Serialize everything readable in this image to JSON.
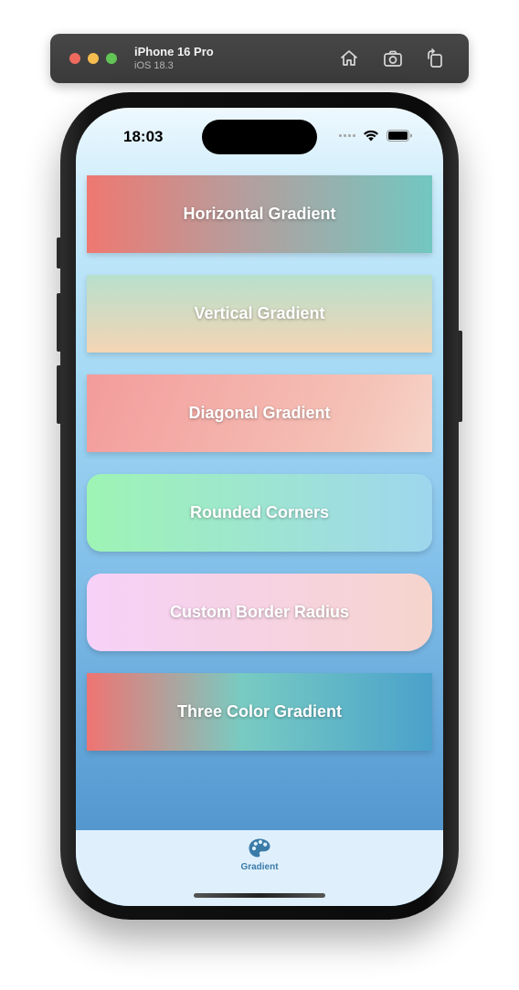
{
  "simulator": {
    "device_name": "iPhone 16 Pro",
    "os_version": "iOS 18.3",
    "buttons": [
      "home-icon",
      "screenshot-icon",
      "rotate-icon"
    ]
  },
  "status_bar": {
    "time": "18:03",
    "icons": [
      "cellular-icon",
      "wifi-icon",
      "battery-icon"
    ]
  },
  "cards": [
    {
      "label": "Horizontal Gradient",
      "colors": [
        "#ef7871",
        "#72c7c1"
      ]
    },
    {
      "label": "Vertical Gradient",
      "colors": [
        "#b7e0cd",
        "#f4d5b4"
      ]
    },
    {
      "label": "Diagonal Gradient",
      "colors": [
        "#f39c9c",
        "#f6d4c8"
      ]
    },
    {
      "label": "Rounded Corners",
      "colors": [
        "#9ef4b4",
        "#9ed6ee"
      ]
    },
    {
      "label": "Custom Border Radius",
      "colors": [
        "#f7d1f8",
        "#f5d4cd"
      ]
    },
    {
      "label": "Three Color Gradient",
      "colors": [
        "#ef7472",
        "#78cbc2",
        "#4aa1cb"
      ]
    }
  ],
  "tab_bar": {
    "items": [
      {
        "label": "Gradient",
        "icon": "palette-icon",
        "color": "#3b7ba8"
      }
    ]
  }
}
